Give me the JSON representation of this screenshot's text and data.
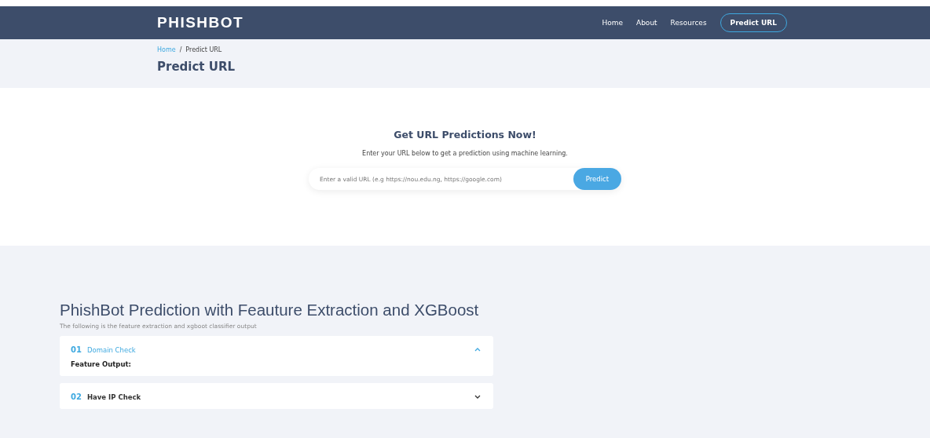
{
  "navbar": {
    "brand": "PHISHBOT",
    "links": [
      {
        "label": "Home",
        "kind": "link"
      },
      {
        "label": "About",
        "kind": "link"
      },
      {
        "label": "Resources",
        "kind": "link"
      },
      {
        "label": "Predict URL",
        "kind": "button"
      }
    ]
  },
  "breadcrumb": {
    "items": [
      "Home",
      "Predict URL"
    ],
    "separator": "/",
    "title": "Predict URL"
  },
  "predict": {
    "heading": "Get URL Predictions Now!",
    "subtitle": "Enter your URL below to get a prediction using machine learning.",
    "placeholder": "Enter a valid URL (e.g https://nou.edu.ng, https://google.com)",
    "button": "Predict"
  },
  "results": {
    "title": "PhishBot Prediction with Feauture Extraction and XGBoost",
    "subtitle": "The following is the feature extraction and xgboot classifier output",
    "items": [
      {
        "number": "01",
        "title": "Domain Check",
        "expanded": true,
        "body": "Feature Output:"
      },
      {
        "number": "02",
        "title": "Have IP Check",
        "expanded": false
      }
    ]
  }
}
